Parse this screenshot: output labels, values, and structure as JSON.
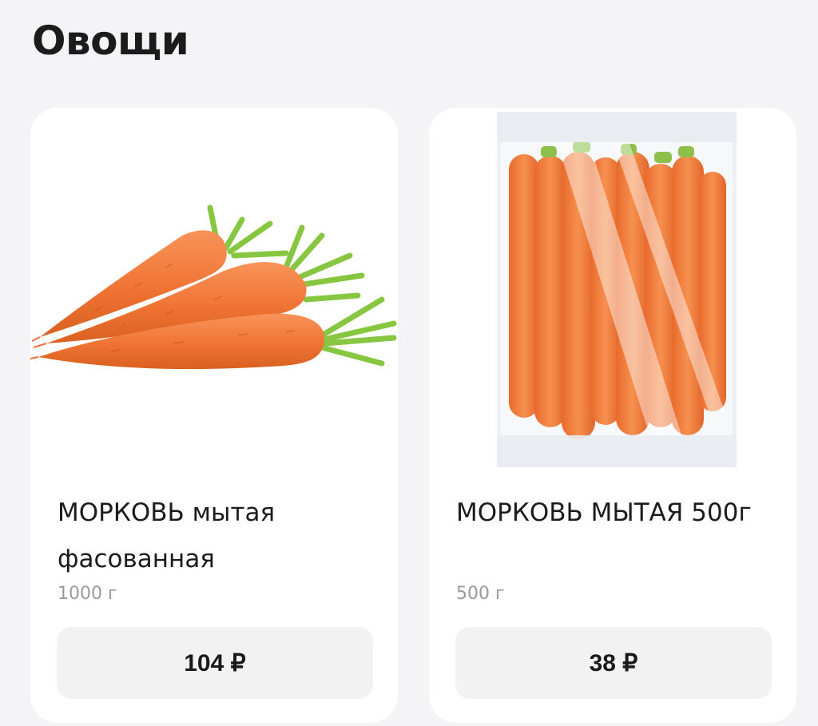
{
  "section": {
    "title": "Овощи"
  },
  "products": [
    {
      "name": "МОРКОВЬ мытая фасованная",
      "weight": "1000 г",
      "price": "104 ₽",
      "image_icon": "carrot-bunch-image"
    },
    {
      "name": "МОРКОВЬ МЫТАЯ 500г",
      "weight": "500 г",
      "price": "38 ₽",
      "image_icon": "carrot-bag-image"
    }
  ],
  "colors": {
    "background": "#f4f4f6",
    "card": "#ffffff",
    "price_button": "#f2f2f3",
    "carrot": "#f07a3a",
    "leaves": "#7cc23b"
  }
}
